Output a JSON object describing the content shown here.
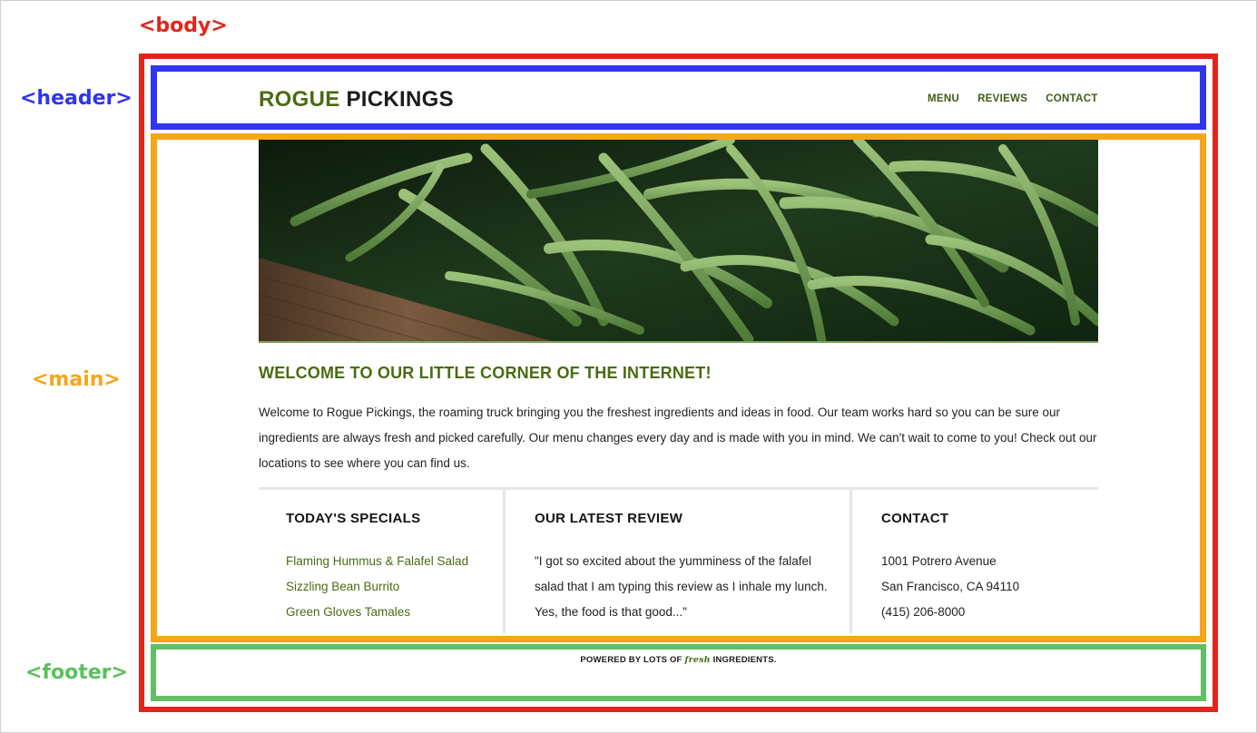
{
  "annotations": {
    "body": "<body>",
    "header": "<header>",
    "main": "<main>",
    "footer": "<footer>"
  },
  "header": {
    "brand_part1": "ROGUE",
    "brand_part2": "PICKINGS",
    "nav": [
      "MENU",
      "REVIEWS",
      "CONTACT"
    ]
  },
  "hero": {
    "image": "green beans in wooden crate"
  },
  "main": {
    "title": "WELCOME TO OUR LITTLE CORNER OF THE INTERNET!",
    "intro": "Welcome to Rogue Pickings, the roaming truck bringing you the freshest ingredients and ideas in food. Our team works hard so you can be sure our ingredients are always fresh and picked carefully. Our menu changes every day and is made with you in mind. We can't wait to come to you! Check out our locations to see where you can find us.",
    "specials": {
      "title": "TODAY'S SPECIALS",
      "items": [
        "Flaming Hummus & Falafel Salad",
        "Sizzling Bean Burrito",
        "Green Gloves Tamales"
      ]
    },
    "review": {
      "title": "OUR LATEST REVIEW",
      "text": "\"I got so excited about the yumminess of the falafel salad that I am typing this review as I inhale my lunch. Yes, the food is that good...\""
    },
    "contact": {
      "title": "CONTACT",
      "lines": [
        "1001 Potrero Avenue",
        "San Francisco, CA 94110",
        "(415) 206-8000"
      ]
    }
  },
  "footer": {
    "prefix": "POWERED BY LOTS OF",
    "fresh": "fresh",
    "suffix": "INGREDIENTS."
  },
  "colors": {
    "body_outline": "#e3241b",
    "header_outline": "#2f35f0",
    "main_outline": "#f7a51b",
    "footer_outline": "#63bf63",
    "brand_green": "#4a6b12"
  }
}
